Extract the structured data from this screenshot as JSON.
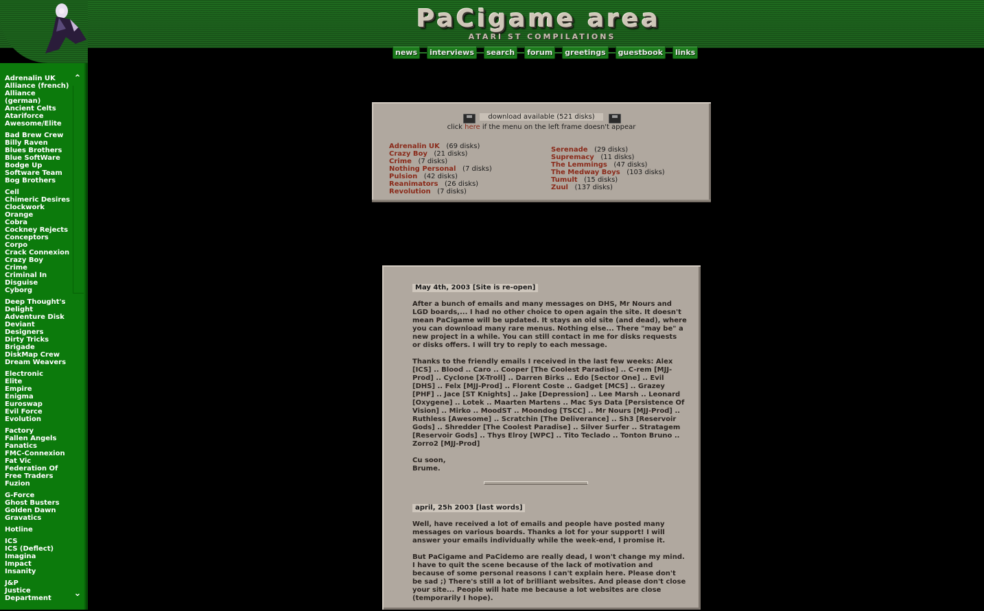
{
  "header": {
    "logo": "PaCigame area",
    "subtitle": "ATARI ST COMPILATIONS"
  },
  "nav": [
    "news",
    "interviews",
    "search",
    "forum",
    "greetings",
    "guestbook",
    "links"
  ],
  "sidebar": {
    "groups": [
      [
        "Adrenalin UK",
        "Alliance (french)",
        "Alliance",
        "(german)",
        "Ancient Celts",
        "Atariforce",
        "Awesome/Elite"
      ],
      [
        "Bad Brew Crew",
        "Billy Raven",
        "Blues Brothers",
        "Blue SoftWare",
        "Bodge Up",
        "Software Team",
        "Bog Brothers"
      ],
      [
        "Cell",
        "Chimeric Desires",
        "Clockwork",
        "Orange",
        "Cobra",
        "Cockney Rejects",
        "Conceptors",
        "Corpo",
        "Crack Connexion",
        "Crazy Boy",
        "Crime",
        "Criminal In",
        "Disguise",
        "Cyborg"
      ],
      [
        "Deep Thought's",
        "Delight",
        "Adventure Disk",
        "Deviant",
        "Designers",
        "Dirty Tricks",
        "Brigade",
        "DiskMap Crew",
        "Dream Weavers"
      ],
      [
        "Electronic",
        "Elite",
        "Empire",
        "Enigma",
        "Euroswap",
        "Evil Force",
        "Evolution"
      ],
      [
        "Factory",
        "Fallen Angels",
        "Fanatics",
        "FMC-Connexion",
        "Fat Vic",
        "Federation Of",
        "Free Traders",
        "Fuzion"
      ],
      [
        "G-Force",
        "Ghost Busters",
        "Golden Dawn",
        "Gravatics"
      ],
      [
        "Hotline"
      ],
      [
        "ICS",
        "ICS (Deflect)",
        "Imagina",
        "Impact",
        "Insanity"
      ],
      [
        "J&P",
        "Justice",
        "Department"
      ]
    ]
  },
  "download": {
    "title": "download available (521 disks)",
    "click_before": "click ",
    "click_link": "here",
    "click_after": " if the menu on the left frame doesn't appear",
    "left": [
      {
        "name": "Adrenalin UK",
        "count": "(69 disks)"
      },
      {
        "name": "Crazy Boy",
        "count": "(21 disks)"
      },
      {
        "name": "Crime",
        "count": "(7 disks)"
      },
      {
        "name": "Nothing Personal",
        "count": "(7 disks)"
      },
      {
        "name": "Pulsion",
        "count": "(42 disks)"
      },
      {
        "name": "Reanimators",
        "count": "(26 disks)"
      },
      {
        "name": "Revolution",
        "count": "(7 disks)"
      }
    ],
    "right": [
      {
        "name": "Serenade",
        "count": "(29 disks)"
      },
      {
        "name": "Supremacy",
        "count": "(11 disks)"
      },
      {
        "name": "The Lemmings",
        "count": "(47 disks)"
      },
      {
        "name": "The Medway Boys",
        "count": "(103 disks)"
      },
      {
        "name": "Tumult",
        "count": "(15 disks)"
      },
      {
        "name": "Zuul",
        "count": "(137 disks)"
      }
    ]
  },
  "news": [
    {
      "date": "May 4th, 2003  [Site is re-open]",
      "paragraphs": [
        "After a bunch of emails and many messages on DHS, Mr Nours and LGD boards,... I had no other choice to open again the site. It doesn't mean PaCigame will be updated. It stays an old site (and dead), where you can download many rare menus. Nothing else... There \"may be\" a new project in a while. You can still contact in me for disks requests or disks offers. I will try to reply to each message.",
        "Thanks to the friendly emails I received in the last few weeks: Alex [ICS] .. Blood .. Caro .. Cooper [The Coolest Paradise] .. C-rem [MJJ-Prod] .. Cyclone [X-Troll] .. Darren Birks .. Edo [Sector One] .. Evil [DHS] .. Felx [MJJ-Prod] .. Florent Coste .. Gadget [MCS] .. Grazey [PHF] .. Jace [ST Knights] .. Jake [Depression] .. Lee Marsh .. Leonard [Oxygene] .. Lotek .. Maarten Martens .. Mac Sys Data [Persistence Of Vision] .. Mirko .. MoodST .. Moondog [TSCC] .. Mr Nours [MJJ-Prod] .. Ruthless [Awesome] .. Scratchin [The Deliverance] .. Sh3 [Reservoir Gods] .. Shredder [The Coolest Paradise] .. Silver Surfer .. Stratagem [Reservoir Gods] .. Thys Elroy [WPC] .. Tito Teclado .. Tonton Bruno .. Zorro2 [MJJ-Prod]",
        "Cu soon,\nBrume."
      ]
    },
    {
      "date": "april, 25h 2003  [last words]",
      "paragraphs": [
        "Well, have received a lot of emails and people have posted many messages on various boards. Thanks a lot for your support! I will answer your emails individually while the week-end, I promise it.",
        "But PaCigame and PaCidemo are really dead, I won't change my mind. I have to quit the scene because of the lack of motivation and because of some personal reasons I can't explain here. Please don't be sad ;) There's still a lot of brilliant websites. And please don't close your site... People will hate me because a lot websites are close (temporarily I hope)."
      ]
    }
  ]
}
